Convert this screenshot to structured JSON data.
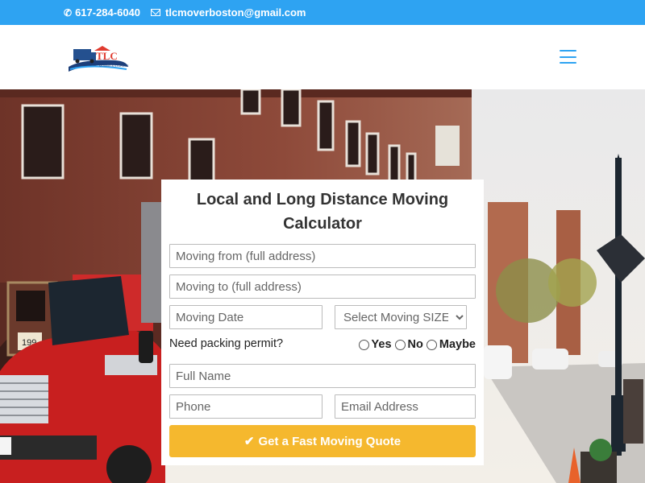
{
  "topbar": {
    "phone": "617-284-6040",
    "email": "tlcmoverboston@gmail.com",
    "phone_icon": "phone-icon",
    "email_icon": "envelope-icon"
  },
  "header": {
    "logo_text": "TLC",
    "logo_tagline": "MOVING & STORAGE",
    "menu_icon": "hamburger-menu-icon"
  },
  "hero": {
    "door_number": "199"
  },
  "form": {
    "title": "Local and Long Distance Moving Calculator",
    "from_placeholder": "Moving from (full address)",
    "to_placeholder": "Moving to (full address)",
    "date_placeholder": "Moving Date",
    "size_selected": "Select Moving SIZE",
    "permit_question": "Need packing permit?",
    "permit_options": [
      "Yes",
      "No",
      "Maybe"
    ],
    "name_placeholder": "Full Name",
    "phone_placeholder": "Phone",
    "email_placeholder": "Email Address",
    "submit_label": "Get a Fast Moving Quote",
    "submit_icon": "check-icon"
  },
  "colors": {
    "topbar": "#2ea3f2",
    "accent": "#2ea3f2",
    "button": "#f5b82e"
  }
}
